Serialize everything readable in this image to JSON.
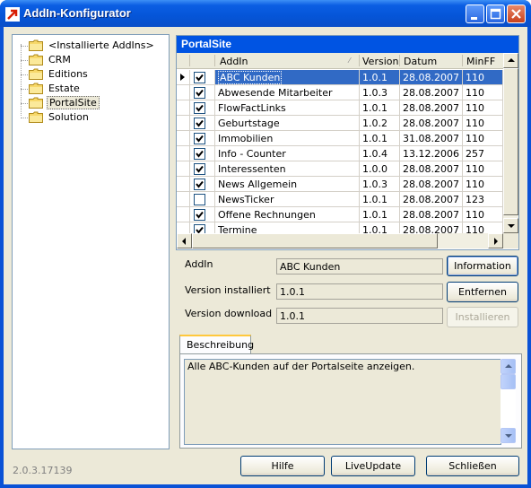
{
  "window": {
    "title": "AddIn-Konfigurator"
  },
  "tree": {
    "items": [
      {
        "label": "<Installierte AddIns>",
        "selected": false
      },
      {
        "label": "CRM",
        "selected": false
      },
      {
        "label": "Editions",
        "selected": false
      },
      {
        "label": "Estate",
        "selected": false
      },
      {
        "label": "PortalSite",
        "selected": true
      },
      {
        "label": "Solution",
        "selected": false
      }
    ]
  },
  "grid": {
    "caption": "PortalSite",
    "columns": [
      "AddIn",
      "Version",
      "Datum",
      "MinFF"
    ],
    "rows": [
      {
        "checked": true,
        "name": "ABC Kunden",
        "version": "1.0.1",
        "date": "28.08.2007",
        "minff": "110",
        "selected": true
      },
      {
        "checked": true,
        "name": "Abwesende Mitarbeiter",
        "version": "1.0.3",
        "date": "28.08.2007",
        "minff": "110"
      },
      {
        "checked": true,
        "name": "FlowFactLinks",
        "version": "1.0.1",
        "date": "28.08.2007",
        "minff": "110"
      },
      {
        "checked": true,
        "name": "Geburtstage",
        "version": "1.0.2",
        "date": "28.08.2007",
        "minff": "110"
      },
      {
        "checked": true,
        "name": "Immobilien",
        "version": "1.0.1",
        "date": "31.08.2007",
        "minff": "110"
      },
      {
        "checked": true,
        "name": "Info - Counter",
        "version": "1.0.4",
        "date": "13.12.2006",
        "minff": "257"
      },
      {
        "checked": true,
        "name": "Interessenten",
        "version": "1.0.0",
        "date": "28.08.2007",
        "minff": "110"
      },
      {
        "checked": true,
        "name": "News Allgemein",
        "version": "1.0.3",
        "date": "28.08.2007",
        "minff": "110"
      },
      {
        "checked": false,
        "name": "NewsTicker",
        "version": "1.0.1",
        "date": "28.08.2007",
        "minff": "123"
      },
      {
        "checked": true,
        "name": "Offene Rechnungen",
        "version": "1.0.1",
        "date": "28.08.2007",
        "minff": "110"
      },
      {
        "checked": true,
        "name": "Termine",
        "version": "1.0.1",
        "date": "28.08.2007",
        "minff": "110"
      }
    ]
  },
  "details": {
    "addin_label": "AddIn",
    "addin_value": "ABC Kunden",
    "installed_label": "Version installiert",
    "installed_value": "1.0.1",
    "download_label": "Version download",
    "download_value": "1.0.1"
  },
  "buttons": {
    "information": "Information",
    "remove": "Entfernen",
    "install": "Installieren",
    "help": "Hilfe",
    "liveupdate": "LiveUpdate",
    "close": "Schließen"
  },
  "description": {
    "tab_label": "Beschreibung",
    "text": "Alle ABC-Kunden auf der Portalseite anzeigen."
  },
  "footer": {
    "version": "2.0.3.17139"
  },
  "colors": {
    "accent": "#0054e3",
    "selection": "#316ac5"
  }
}
